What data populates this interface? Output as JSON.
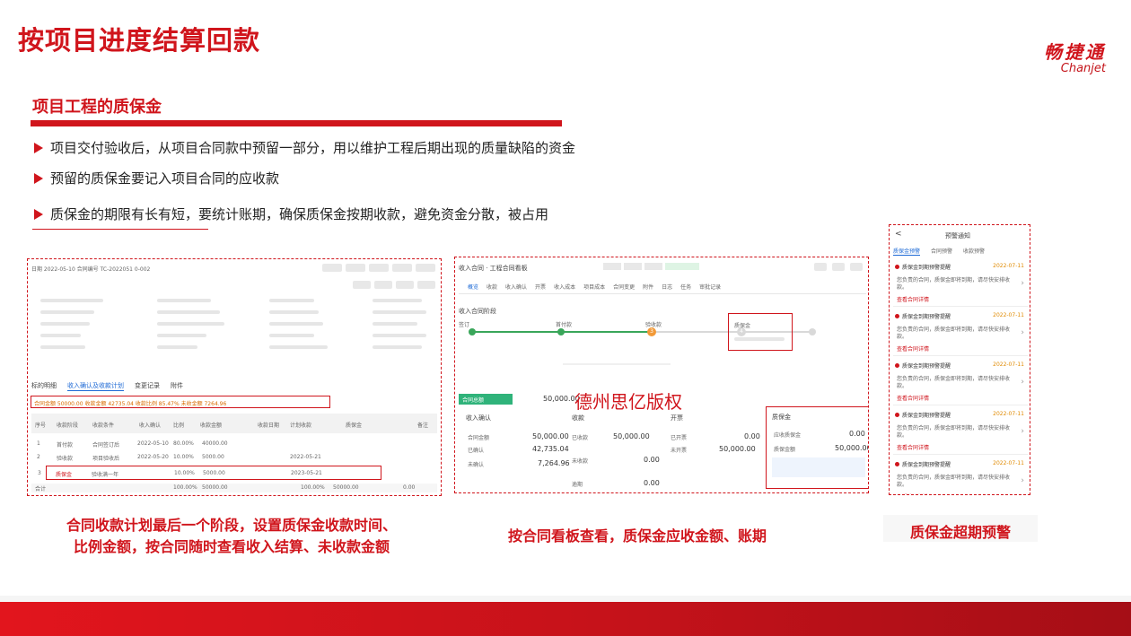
{
  "slide": {
    "title": "按项目进度结算回款",
    "logo_cn": "畅捷通",
    "logo_en": "Chanjet",
    "section_title": "项目工程的质保金",
    "bullets": [
      "项目交付验收后，从项目合同款中预留一部分，用以维护工程后期出现的质量缺陷的资金",
      "预留的质保金要记入项目合同的应收款",
      "质保金的期限有长有短，要统计账期，确保质保金按期收款，避免资金分散，被占用"
    ],
    "captions": {
      "left_line1": "合同收款计划最后一个阶段，设置质保金收款时间、",
      "left_line2": "比例金额，按合同随时查看收入结算、未收款金额",
      "middle": "按合同看板查看，质保金应收金额、账期",
      "right": "质保金超期预警"
    },
    "watermark": "德州思亿版权"
  },
  "contract_panel": {
    "header_left": "日期 2022-05-10    合同编号 TC-2022051 0-002",
    "tabs": [
      "标的明细",
      "收入确认及收款计划",
      "变更记录",
      "附件"
    ],
    "summary_line": "合同金额 50000.00    收款金额 42735.04    收款比例 85.47%    未收金额 7264.96",
    "col_headers": [
      "序号",
      "收款阶段",
      "收款条件",
      "收入确认",
      "比例",
      "收款金额",
      "收款日期",
      "计划收款",
      "质保金",
      "备注"
    ],
    "rows": [
      [
        "1",
        "首付款",
        "合同签订后",
        "2022-05-10",
        "80.00%",
        "40000.00",
        "",
        "",
        "",
        ""
      ],
      [
        "2",
        "验收款",
        "项目验收后",
        "2022-05-20",
        "10.00%",
        "5000.00",
        "",
        "2022-05-21",
        "",
        ""
      ],
      [
        "3",
        "质保金",
        "验收满一年",
        "",
        "10.00%",
        "5000.00",
        "",
        "2023-05-21",
        "",
        ""
      ]
    ],
    "total_label": "合计",
    "total_ratio": "100.00%",
    "total_amount": "50000.00",
    "total_plan": "100.00%",
    "total_plan_amount": "50000.00",
    "total_zero": "0.00"
  },
  "board_panel": {
    "header": "收入合同 · 工程合同看板",
    "tabs": [
      "概览",
      "收款",
      "收入确认",
      "开票",
      "收入成本",
      "项目成本",
      "合同变更",
      "附件",
      "日志",
      "任务",
      "审批记录"
    ],
    "timeline_title": "收入合同阶段",
    "stages": [
      "签订",
      "首付款",
      "验收款",
      "质保金"
    ],
    "stage_badge": "3",
    "stage_current": "4",
    "summary_tab": "合同总额",
    "summary_value": "50,000.00",
    "cards": [
      {
        "title": "收入确认",
        "rows": [
          [
            "合同金额",
            "50,000.00"
          ],
          [
            "已确认",
            "42,735.04"
          ],
          [
            "未确认",
            "7,264.96"
          ]
        ]
      },
      {
        "title": "收款",
        "rows": [
          [
            "已收款",
            "50,000.00"
          ],
          [
            "未收款",
            "0.00"
          ],
          [
            "逾期",
            "0.00"
          ]
        ]
      },
      {
        "title": "开票",
        "rows": [
          [
            "已开票",
            "0.00"
          ],
          [
            "未开票",
            "50,000.00"
          ]
        ]
      },
      {
        "title": "质保金",
        "rows": [
          [
            "应收质保金",
            "0.00"
          ],
          [
            "质保金额",
            "50,000.00"
          ]
        ]
      }
    ]
  },
  "alert_panel": {
    "header": "预警通知",
    "back": "<",
    "tabs": [
      "质保金预警",
      "合同预警",
      "收款预警"
    ],
    "item_title": "质保金到期预警提醒",
    "item_text": "您负责的合同，质保金即将到期，请尽快安排收款。",
    "item_link": "查看合同详情",
    "item_date": "2022-07-11",
    "count": 5
  }
}
